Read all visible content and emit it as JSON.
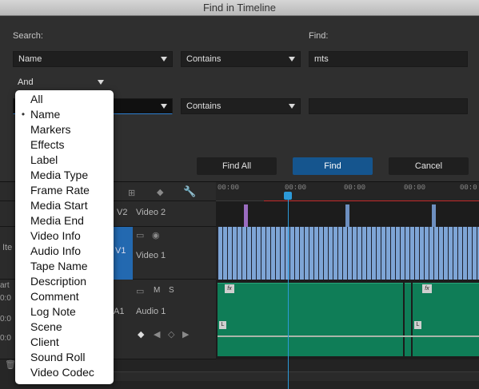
{
  "dialog": {
    "title": "Find in Timeline",
    "search_label": "Search:",
    "find_label": "Find:",
    "row1": {
      "field": "Name",
      "operator": "Contains",
      "value": "mts"
    },
    "conjunction": "And",
    "row2": {
      "field": "",
      "operator": "Contains",
      "value": ""
    },
    "buttons": {
      "find_all": "Find All",
      "find": "Find",
      "cancel": "Cancel"
    }
  },
  "dropdown": {
    "selected": "Name",
    "items": [
      "All",
      "Name",
      "Markers",
      "Effects",
      "Label",
      "Media Type",
      "Frame Rate",
      "Media Start",
      "Media End",
      "Video Info",
      "Audio Info",
      "Tape Name",
      "Description",
      "Comment",
      "Log Note",
      "Scene",
      "Client",
      "Sound Roll",
      "Video Codec"
    ]
  },
  "timeline": {
    "ruler_ticks": [
      "00:00",
      "00:00",
      "00:00",
      "00:00",
      "00:0"
    ],
    "tracks": {
      "v2": {
        "id": "V2",
        "name": "Video 2"
      },
      "v1": {
        "id": "V1",
        "name": "Video 1"
      },
      "a1": {
        "id": "A1",
        "name": "Audio 1"
      }
    },
    "a1_controls": {
      "mute": "M",
      "solo": "S"
    },
    "fragments": {
      "ite": "Ite",
      "art": "art",
      "zero1": "0:0",
      "zero2": "0:0",
      "zero3": "0:0"
    },
    "badges": {
      "fx": "fx",
      "l": "L"
    }
  },
  "colors": {
    "accent": "#15558e",
    "video_clip": "#7ea5d6",
    "audio_clip": "#0f7d57",
    "playhead": "#2c9ad9",
    "work_area": "#c52a2a"
  }
}
